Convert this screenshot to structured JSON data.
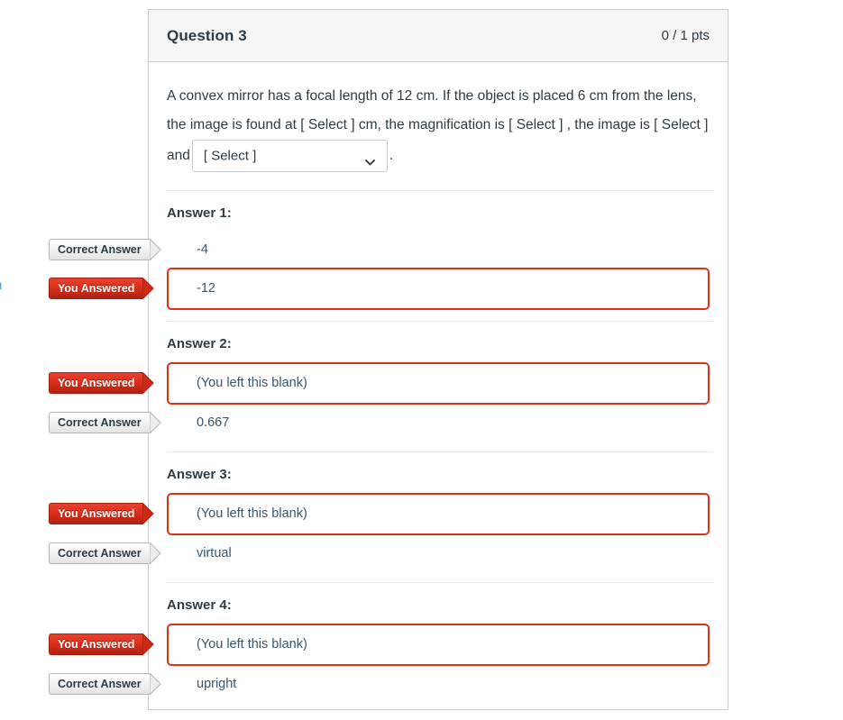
{
  "edge_fragment": "n",
  "question": {
    "title": "Question 3",
    "points": "0 / 1 pts",
    "text_part_1": "A convex mirror has a focal length of 12 cm. If the object is placed  6 cm from the lens, the image is found at [ Select ] cm, the magnification is [ Select ] , the image is [ Select ] and",
    "text_part_2": ".",
    "select": {
      "value": "[ Select ]",
      "chevron_icon": "chevron-down-icon"
    }
  },
  "flags": {
    "correct": "Correct Answer",
    "answered": "You Answered"
  },
  "answers": [
    {
      "label": "Answer 1:",
      "rows": [
        {
          "kind": "correct",
          "flag": "Correct Answer",
          "value": "-4"
        },
        {
          "kind": "answered",
          "flag": "You Answered",
          "value": "-12"
        }
      ]
    },
    {
      "label": "Answer 2:",
      "rows": [
        {
          "kind": "answered",
          "flag": "You Answered",
          "value": "(You left this blank)"
        },
        {
          "kind": "correct",
          "flag": "Correct Answer",
          "value": "0.667"
        }
      ]
    },
    {
      "label": "Answer 3:",
      "rows": [
        {
          "kind": "answered",
          "flag": "You Answered",
          "value": "(You left this blank)"
        },
        {
          "kind": "correct",
          "flag": "Correct Answer",
          "value": "virtual"
        }
      ]
    },
    {
      "label": "Answer 4:",
      "rows": [
        {
          "kind": "answered",
          "flag": "You Answered",
          "value": "(You left this blank)"
        },
        {
          "kind": "correct",
          "flag": "Correct Answer",
          "value": "upright"
        }
      ]
    }
  ],
  "colors": {
    "accent_red": "#e0301e",
    "flag_red_dark": "#ad2111",
    "text": "#2d3b45",
    "border": "#c7cdd1",
    "header_bg": "#f5f5f5"
  }
}
